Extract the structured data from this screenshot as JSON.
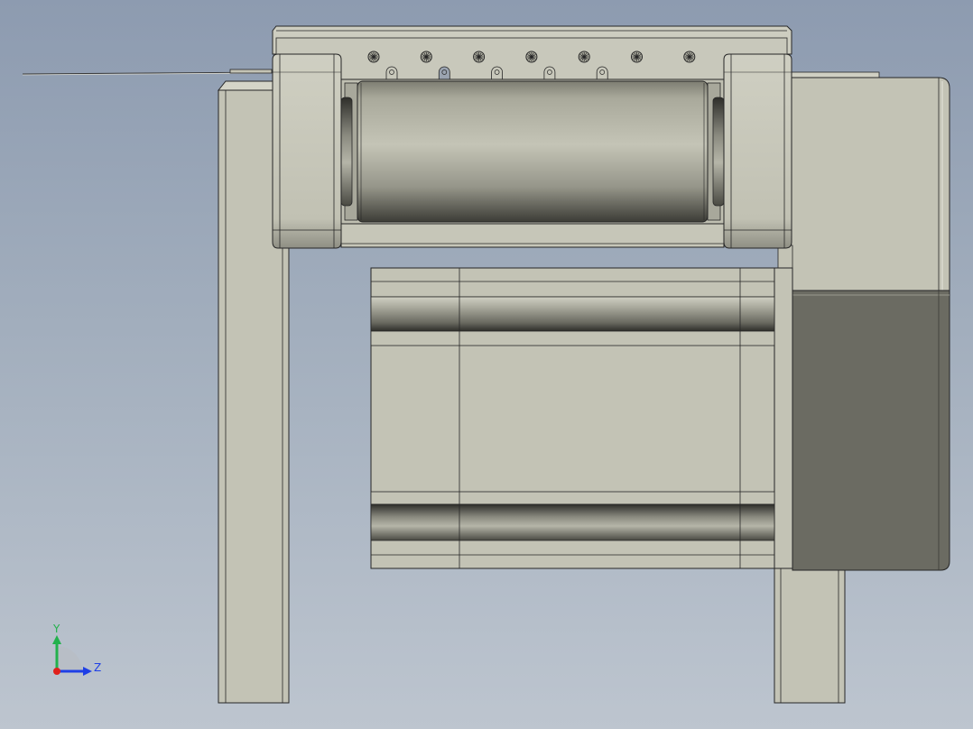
{
  "viewport": {
    "background_top": "#8d9bb0",
    "background_bottom": "#bdc5cf"
  },
  "model": {
    "body_color": "#c3c3b5",
    "motor_dark_color": "#6b6b62",
    "edge_color": "#262626",
    "screw_count": 7,
    "pin_count": 5
  },
  "triad": {
    "y_label": "Y",
    "z_label": "Z",
    "y_color": "#22b14c",
    "z_color": "#1e3fe6",
    "x_color": "#e0201b"
  }
}
